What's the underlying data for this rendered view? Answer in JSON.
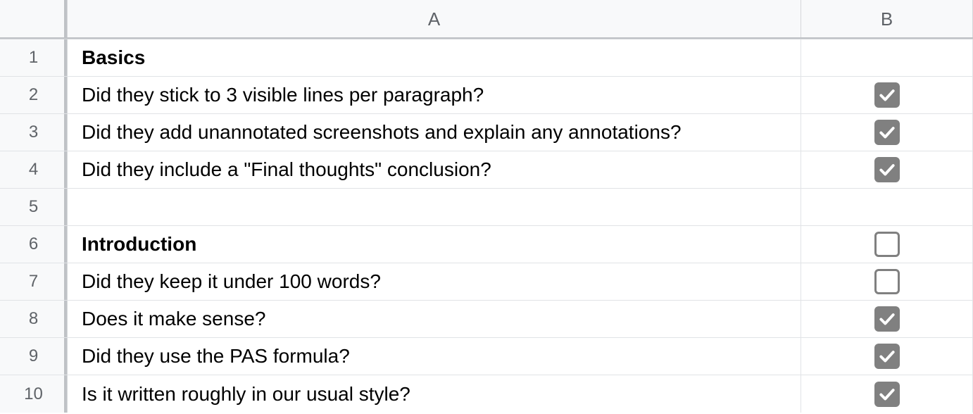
{
  "columns": {
    "A": "A",
    "B": "B"
  },
  "rows": [
    {
      "num": "1",
      "a": "Basics",
      "bold": true,
      "b": null
    },
    {
      "num": "2",
      "a": "Did they stick to 3 visible lines per paragraph?",
      "bold": false,
      "b": true
    },
    {
      "num": "3",
      "a": "Did they add unannotated screenshots and explain any annotations?",
      "bold": false,
      "b": true
    },
    {
      "num": "4",
      "a": "Did they include a \"Final thoughts\" conclusion?",
      "bold": false,
      "b": true
    },
    {
      "num": "5",
      "a": "",
      "bold": false,
      "b": null
    },
    {
      "num": "6",
      "a": "Introduction",
      "bold": true,
      "b": false
    },
    {
      "num": "7",
      "a": "Did they keep it under 100 words?",
      "bold": false,
      "b": false
    },
    {
      "num": "8",
      "a": "Does it make sense?",
      "bold": false,
      "b": true
    },
    {
      "num": "9",
      "a": "Did they use the PAS formula?",
      "bold": false,
      "b": true
    },
    {
      "num": "10",
      "a": "Is it written roughly in our usual style?",
      "bold": false,
      "b": true
    }
  ]
}
